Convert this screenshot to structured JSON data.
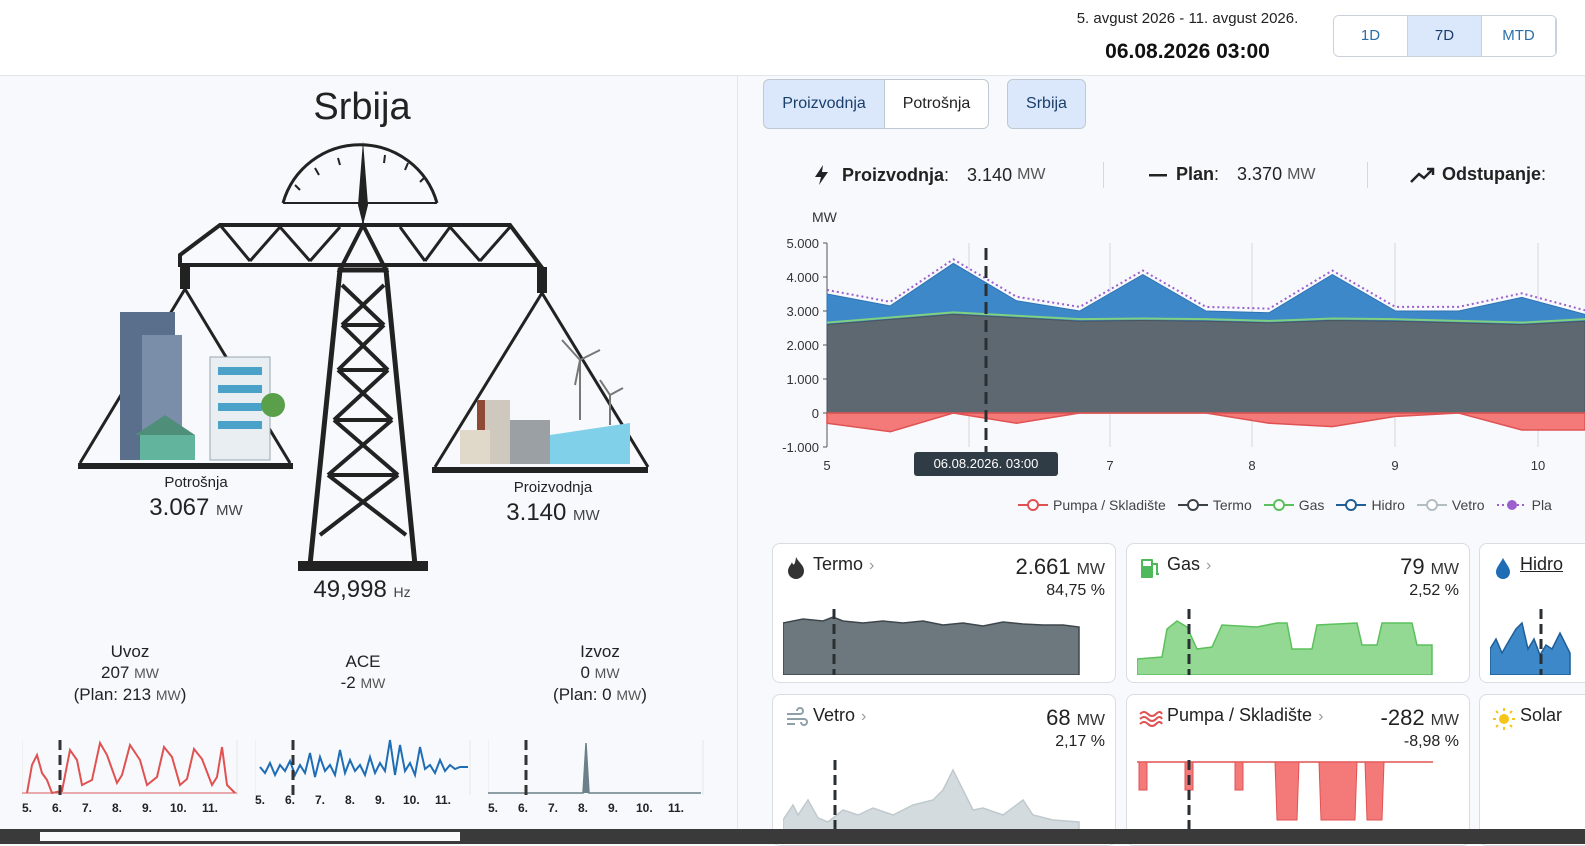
{
  "header": {
    "date_range": "5. avgust 2026 - 11. avgust 2026.",
    "current_time": "06.08.2026 03:00",
    "periods": [
      "1D",
      "7D",
      "MTD"
    ],
    "active_period": "7D"
  },
  "left": {
    "title": "Srbija",
    "consumption": {
      "label": "Potrošnja",
      "value": "3.067",
      "unit": "MW"
    },
    "production": {
      "label": "Proizvodnja",
      "value": "3.140",
      "unit": "MW"
    },
    "frequency": {
      "value": "49,998",
      "unit": "Hz"
    },
    "import": {
      "label": "Uvoz",
      "value": "207",
      "unit": "MW",
      "plan_prefix": "(Plan: 213",
      "plan_suffix": ")"
    },
    "ace": {
      "label": "ACE",
      "value": "-2",
      "unit": "MW"
    },
    "export": {
      "label": "Izvoz",
      "value": "0",
      "unit": "MW",
      "plan_prefix": "(Plan: 0",
      "plan_suffix": ")"
    },
    "spark_ticks": [
      "5.",
      "6.",
      "7.",
      "8.",
      "9.",
      "10.",
      "11."
    ]
  },
  "right": {
    "tabs": [
      "Proizvodnja",
      "Potrošnja"
    ],
    "active_tab": "Proizvodnja",
    "region": "Srbija",
    "kpis": {
      "production_label": "Proizvodnja",
      "production_sep": ":",
      "production_value": "3.140",
      "production_unit": "MW",
      "plan_label": "Plan",
      "plan_sep": ":",
      "plan_value": "3.370",
      "plan_unit": "MW",
      "deviation_label": "Odstupanje",
      "deviation_sep": ":"
    },
    "legend": [
      "Pumpa / Skladište",
      "Termo",
      "Gas",
      "Hidro",
      "Vetro",
      "Pla"
    ],
    "cards": [
      {
        "name": "Termo",
        "value": "2.661",
        "unit": "MW",
        "pct": "84,75 %"
      },
      {
        "name": "Gas",
        "value": "79",
        "unit": "MW",
        "pct": "2,52 %"
      },
      {
        "name": "Hidro"
      },
      {
        "name": "Vetro",
        "value": "68",
        "unit": "MW",
        "pct": "2,17 %"
      },
      {
        "name": "Pumpa / Skladište",
        "value": "-282",
        "unit": "MW",
        "pct": "-8,98 %"
      },
      {
        "name": "Solar"
      }
    ]
  },
  "colors": {
    "termo": "#5d6870",
    "hidro": "#3d88c9",
    "gas": "#7fd07f",
    "pumpa": "#f47a7a",
    "vetro": "#c8d0d4",
    "plan": "#9b5fce",
    "accent": "#dbe8fb"
  },
  "chart_data": {
    "type": "area",
    "ylabel": "MW",
    "ylim": [
      -1000,
      5000
    ],
    "yticks": [
      "5.000",
      "4.000",
      "3.000",
      "2.000",
      "1.000",
      "0",
      "-1.000"
    ],
    "x": [
      "5",
      "7",
      "8",
      "9",
      "10"
    ],
    "cursor_label": "06.08.2026. 03:00",
    "series": [
      {
        "name": "Termo",
        "values": [
          2600,
          2750,
          2900,
          2800,
          2700,
          2720,
          2700,
          2650,
          2720,
          2700,
          2650,
          2600,
          2700
        ]
      },
      {
        "name": "Hidro",
        "values": [
          900,
          400,
          1500,
          500,
          300,
          1350,
          300,
          300,
          1350,
          300,
          350,
          800,
          200
        ]
      },
      {
        "name": "Pumpa / Skladište",
        "values": [
          -300,
          -550,
          0,
          -300,
          0,
          0,
          0,
          -300,
          -400,
          -100,
          0,
          -500,
          -500
        ]
      }
    ]
  }
}
